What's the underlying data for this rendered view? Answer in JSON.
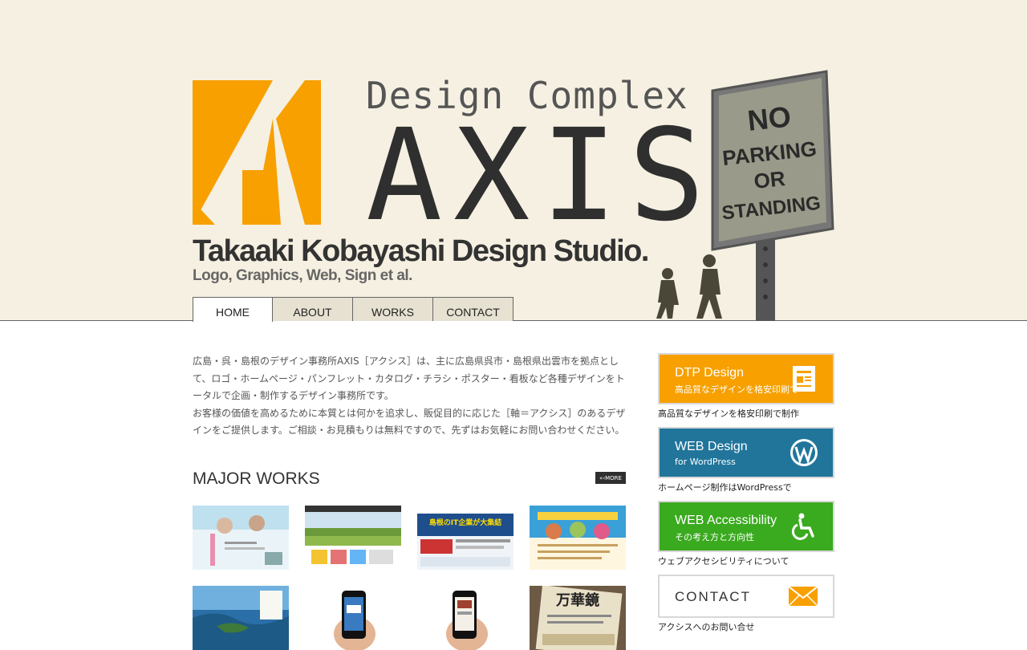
{
  "brand": {
    "tagline": "Design Complex",
    "name": "AXIS",
    "studio": "Takaaki Kobayashi Design Studio.",
    "studio_sub": "Logo, Graphics, Web, Sign et al.",
    "sign_text": [
      "NO",
      "PARKING",
      "OR",
      "STANDING"
    ]
  },
  "nav": {
    "items": [
      {
        "label": "HOME"
      },
      {
        "label": "ABOUT"
      },
      {
        "label": "WORKS"
      },
      {
        "label": "CONTACT"
      }
    ],
    "active": "HOME"
  },
  "intro": {
    "paragraph1": "広島・呉・島根のデザイン事務所AXIS［アクシス］は、主に広島県呉市・島根県出雲市を拠点として、ロゴ・ホームページ・パンフレット・カタログ・チラシ・ポスター・看板など各種デザインをトータルで企画・制作するデザイン事務所です。",
    "paragraph2": "お客様の価値を高めるために本質とは何かを追求し、販促目的に応じた［軸＝アクシス］のあるデザインをご提供します。ご相談・お見積もりは無料ですので、先ずはお気軽にお問い合わせください。"
  },
  "works": {
    "title": "MAJOR WORKS",
    "more_label": "MORE",
    "thumb2_text": "島根のIT企業が大集結",
    "thumb8_text": "万華鏡"
  },
  "sidebar": {
    "banners": [
      {
        "title": "DTP Design",
        "sub": "高品質なデザインを格安印刷で",
        "caption": "高品質なデザインを格安印刷で制作",
        "color": "#f7a000"
      },
      {
        "title": "WEB Design",
        "sub": "for WordPress",
        "caption": "ホームページ制作はWordPressで",
        "color": "#21759b"
      },
      {
        "title": "WEB Accessibility",
        "sub": "その考え方と方向性",
        "caption": "ウェブアクセシビリティについて",
        "color": "#3aaa1f"
      }
    ],
    "contact": {
      "title": "CONTACT",
      "caption": "アクシスへのお問い合せ",
      "accent": "#f7a000"
    }
  },
  "colors": {
    "header_bg": "#f5f0e1",
    "logo_orange": "#f7a000",
    "text_dark": "#333333"
  }
}
